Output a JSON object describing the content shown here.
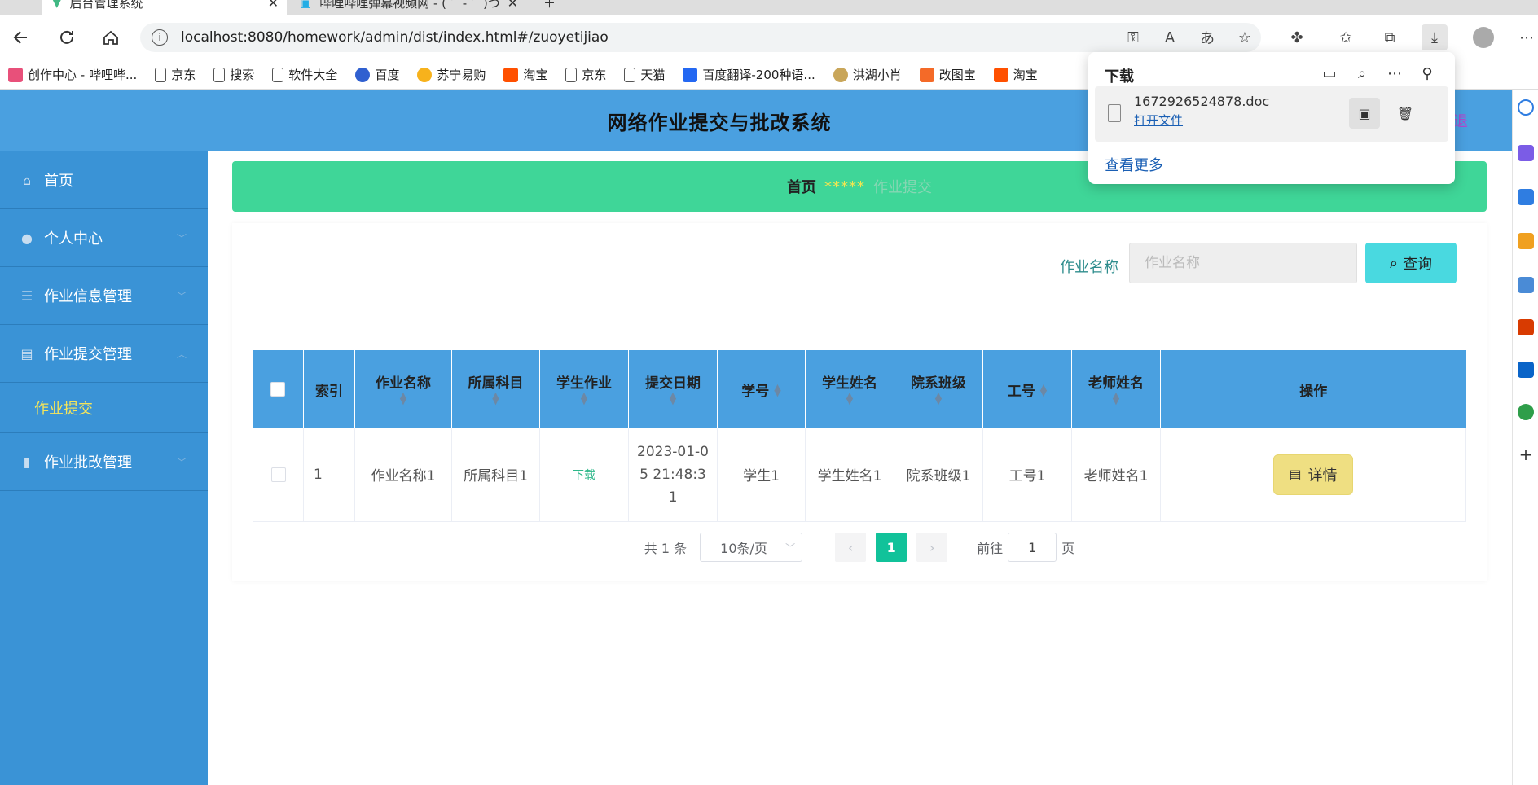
{
  "browser": {
    "tabs": [
      {
        "title": "后台管理系统",
        "active": true
      },
      {
        "title": "哔哩哔哩弹幕视频网 - ( ゜- ゜)つ",
        "active": false
      }
    ],
    "url": "localhost:8080/homework/admin/dist/index.html#/zuoyetijiao",
    "bookmarks": [
      "创作中心 - 哔哩哔...",
      "京东",
      "搜索",
      "软件大全",
      "百度",
      "苏宁易购",
      "淘宝",
      "京东",
      "天猫",
      "百度翻译-200种语...",
      "洪湖小肖",
      "改图宝",
      "淘宝"
    ]
  },
  "downloads": {
    "title": "下载",
    "file_name": "1672926524878.doc",
    "open_label": "打开文件",
    "more_label": "查看更多"
  },
  "app": {
    "title": "网络作业提交与批改系统",
    "header_right": "退"
  },
  "sidebar": {
    "items": [
      {
        "label": "首页",
        "icon": "home-icon"
      },
      {
        "label": "个人中心",
        "icon": "user-icon"
      },
      {
        "label": "作业信息管理",
        "icon": "list-icon"
      },
      {
        "label": "作业提交管理",
        "icon": "clipboard-icon",
        "expanded": true
      },
      {
        "label": "作业批改管理",
        "icon": "mic-icon"
      }
    ],
    "submenu_label": "作业提交"
  },
  "breadcrumb": {
    "home": "首页",
    "separator": "*****",
    "current": "作业提交"
  },
  "search": {
    "label": "作业名称",
    "placeholder": "作业名称",
    "button_label": "查询"
  },
  "table": {
    "headers": [
      "索引",
      "作业名称",
      "所属科目",
      "学生作业",
      "提交日期",
      "学号",
      "学生姓名",
      "院系班级",
      "工号",
      "老师姓名",
      "操作"
    ],
    "rows": [
      {
        "index": "1",
        "homework_name": "作业名称1",
        "subject": "所属科目1",
        "student_homework": "下载",
        "submit_date": "2023-01-05 21:48:31",
        "student_no": "学生1",
        "student_name": "学生姓名1",
        "department_class": "院系班级1",
        "staff_no": "工号1",
        "teacher_name": "老师姓名1",
        "action": "详情"
      }
    ]
  },
  "pagination": {
    "total_text": "共 1 条",
    "page_size": "10条/页",
    "current_page": "1",
    "goto_prefix": "前往",
    "goto_value": "1",
    "goto_suffix": "页"
  },
  "colors": {
    "header_bg": "#4aa0e0",
    "sidebar_bg": "#3a93d6",
    "breadcrumb_bg": "#3fd698",
    "query_btn": "#49d9e0",
    "detail_btn": "#efdf82",
    "page_active": "#11c29a"
  }
}
